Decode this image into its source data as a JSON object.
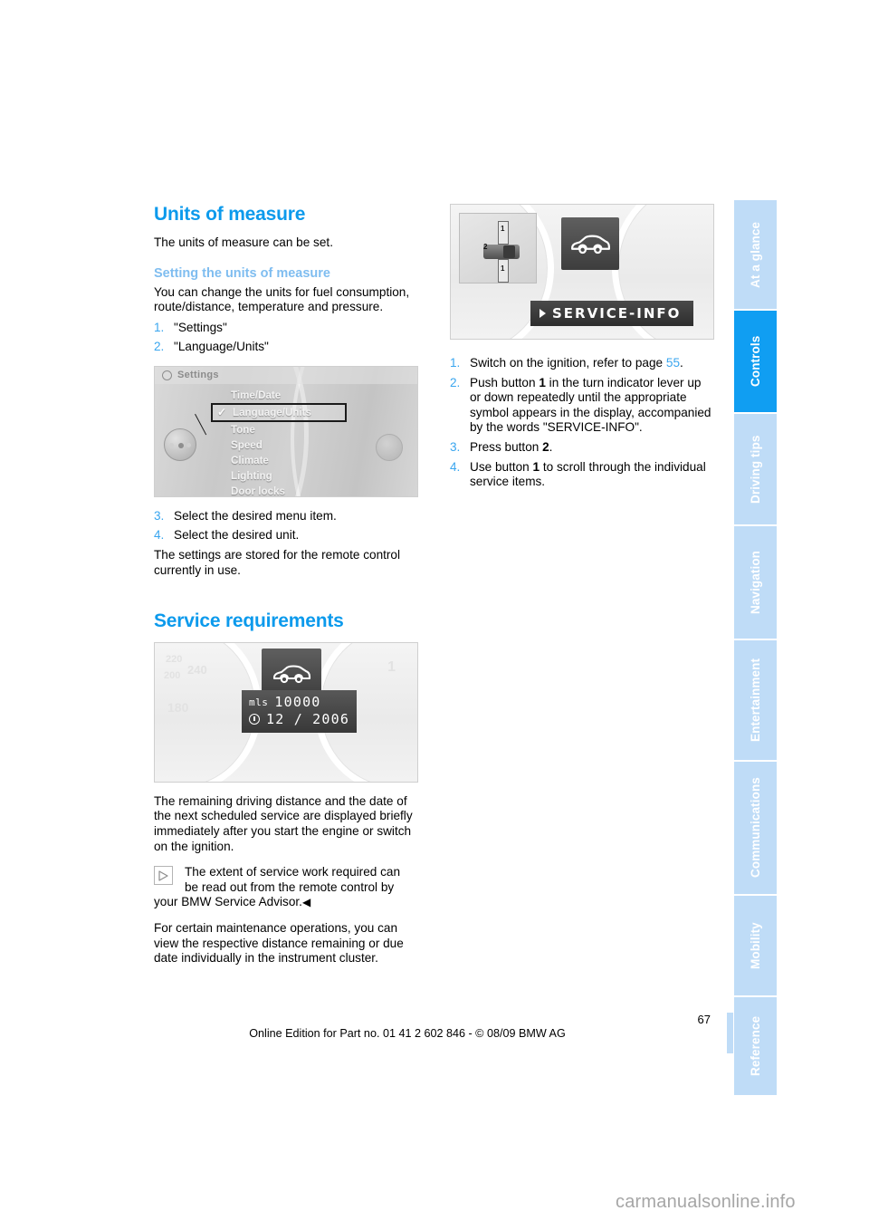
{
  "sidebar": {
    "items": [
      {
        "label": "At a glance",
        "active": false
      },
      {
        "label": "Controls",
        "active": true
      },
      {
        "label": "Driving tips",
        "active": false
      },
      {
        "label": "Navigation",
        "active": false
      },
      {
        "label": "Entertainment",
        "active": false
      },
      {
        "label": "Communications",
        "active": false
      },
      {
        "label": "Mobility",
        "active": false
      },
      {
        "label": "Reference",
        "active": false
      }
    ],
    "active_color": "#109ef2",
    "inactive_color": "#bfdcf7"
  },
  "left_column": {
    "heading": "Units of measure",
    "intro": "The units of measure can be set.",
    "subheading": "Setting the units of measure",
    "paragraph": "You can change the units for fuel consumption, route/distance, temperature and pressure.",
    "steps_top": [
      {
        "num": "1.",
        "text": "\"Settings\""
      },
      {
        "num": "2.",
        "text": "\"Language/Units\""
      }
    ],
    "steps_bottom": [
      {
        "num": "3.",
        "text": "Select the desired menu item."
      },
      {
        "num": "4.",
        "text": "Select the desired unit."
      }
    ],
    "closing": "The settings are stored for the remote control currently in use.",
    "heading2": "Service requirements",
    "service_paragraph": "The remaining driving distance and the date of the next scheduled service are displayed briefly immediately after you start the engine or switch on the ignition.",
    "note": {
      "icon": "triangle-right-icon",
      "line1": "The extent of service work required can",
      "line2": "be read out from the remote control by",
      "line3": "your BMW Service Advisor.",
      "end_marker": "◀"
    },
    "final_paragraph": "For certain maintenance operations, you can view the respective distance remaining or due date individually in the instrument cluster."
  },
  "right_column": {
    "steps": [
      {
        "num": "1.",
        "text_before": "Switch on the ignition, refer to page ",
        "page_ref": "55",
        "text_after": "."
      },
      {
        "num": "2.",
        "text_before": "Push button ",
        "bold": "1",
        "text_after": " in the turn indicator lever up or down repeatedly until the appropriate symbol appears in the display, accompanied by the words \"SERVICE-INFO\"."
      },
      {
        "num": "3.",
        "text_before": "Press button ",
        "bold": "2",
        "text_after": "."
      },
      {
        "num": "4.",
        "text_before": "Use button ",
        "bold": "1",
        "text_after": " to scroll through the individual service items."
      }
    ]
  },
  "figures": {
    "idrive_menu": {
      "title": "Settings",
      "title_icon": "gear-icon",
      "items": [
        {
          "label": "Time/Date",
          "selected": false
        },
        {
          "label": "Language/Units",
          "selected": true
        },
        {
          "label": "Tone",
          "selected": false
        },
        {
          "label": "Speed",
          "selected": false
        },
        {
          "label": "Climate",
          "selected": false
        },
        {
          "label": "Lighting",
          "selected": false
        },
        {
          "label": "Door locks",
          "selected": false
        }
      ],
      "check_mark": "✓"
    },
    "service_info": {
      "display_text": "SERVICE-INFO",
      "callout_up": "1",
      "callout_button": "2",
      "car_icon": "car-silhouette-icon"
    },
    "cluster": {
      "unit_label": "mls",
      "distance_value": "10000",
      "date_value": "12 / 2006",
      "car_icon": "car-silhouette-icon",
      "dial_ticks_left": [
        "220",
        "240",
        "200",
        "180"
      ],
      "dial_ticks_right": [
        "1"
      ]
    }
  },
  "footer": {
    "edition": "Online Edition for Part no. 01 41 2 602 846 - © 08/09 BMW AG",
    "page_number": "67"
  },
  "watermark": "carmanualsonline.info"
}
